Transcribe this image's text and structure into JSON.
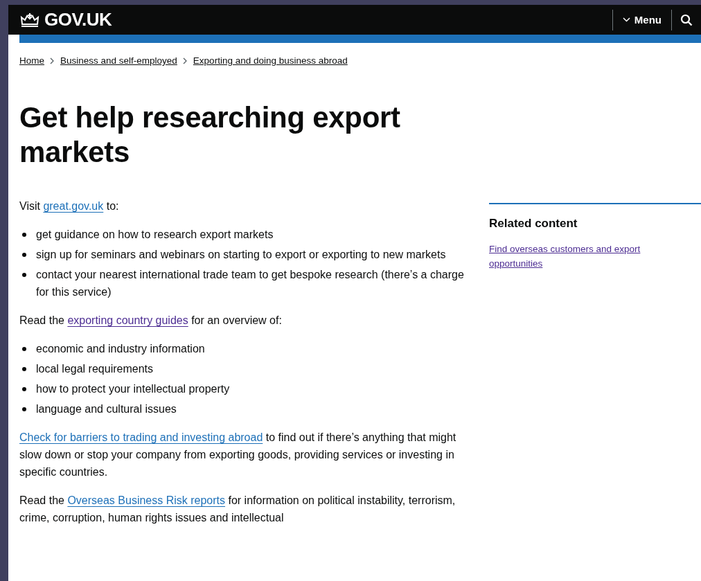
{
  "header": {
    "logo": "GOV.UK",
    "menu": "Menu"
  },
  "breadcrumbs": [
    {
      "label": "Home"
    },
    {
      "label": "Business and self-employed"
    },
    {
      "label": "Exporting and doing business abroad"
    }
  ],
  "title": "Get help researching export markets",
  "body": [
    {
      "kind": "paragraph",
      "parts": [
        {
          "text": "Visit "
        },
        {
          "link": "great.gov.uk",
          "visited": false
        },
        {
          "text": " to:"
        }
      ]
    },
    {
      "kind": "list",
      "items": [
        "get guidance on how to research export markets",
        "sign up for seminars and webinars on starting to export or exporting to new markets",
        "contact your nearest international trade team to get bespoke research (there’s a charge for this service)"
      ]
    },
    {
      "kind": "paragraph",
      "parts": [
        {
          "text": "Read the "
        },
        {
          "link": "exporting country guides",
          "visited": true
        },
        {
          "text": " for an overview of:"
        }
      ]
    },
    {
      "kind": "list",
      "items": [
        "economic and industry information",
        "local legal requirements",
        "how to protect your intellectual property",
        "language and cultural issues"
      ]
    },
    {
      "kind": "paragraph",
      "parts": [
        {
          "link": "Check for barriers to trading and investing abroad",
          "visited": false
        },
        {
          "text": " to find out if there’s anything that might slow down or stop your company from exporting goods, providing services or investing in specific countries."
        }
      ]
    },
    {
      "kind": "paragraph",
      "parts": [
        {
          "text": "Read the "
        },
        {
          "link": "Overseas Business Risk reports",
          "visited": false
        },
        {
          "text": " for information on political instability, terrorism, crime, corruption, human rights issues and intellectual"
        }
      ]
    }
  ],
  "related": {
    "heading": "Related content",
    "links": [
      {
        "label": "Find overseas customers and export opportunities",
        "visited": true
      }
    ]
  }
}
